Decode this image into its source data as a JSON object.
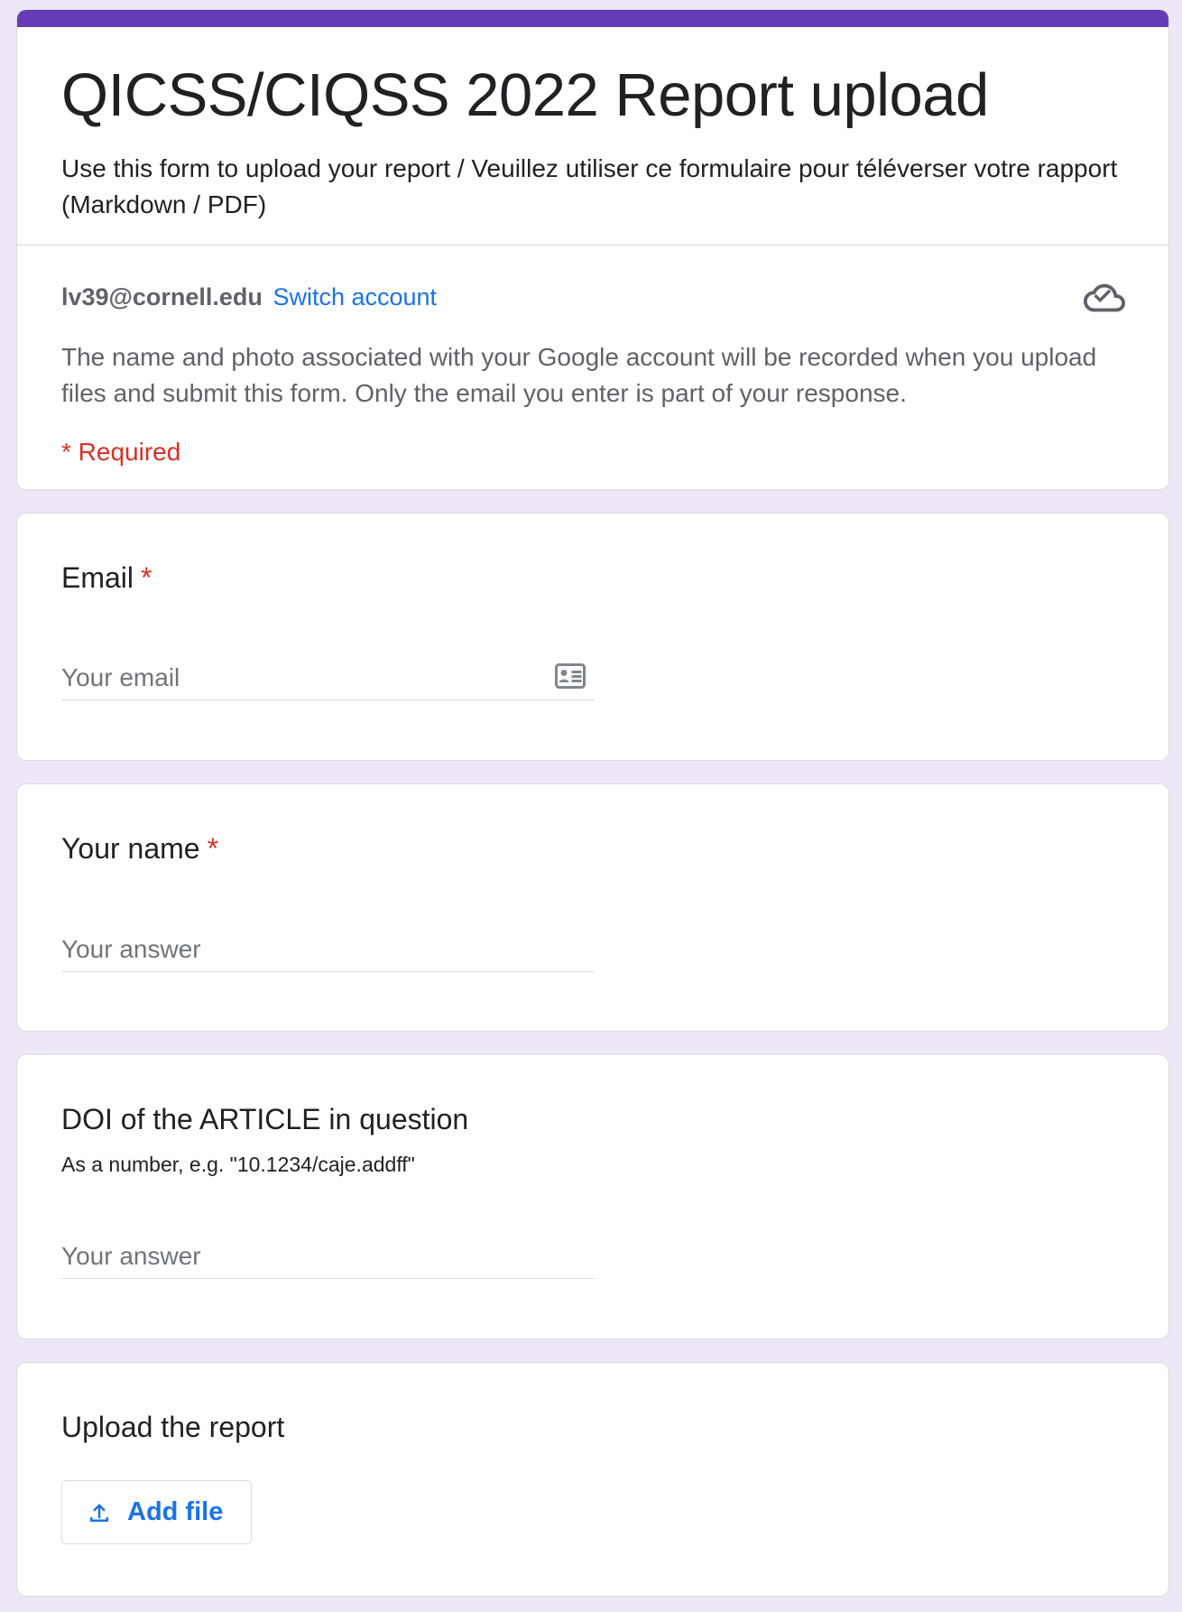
{
  "header": {
    "title": "QICSS/CIQSS 2022 Report upload",
    "description": "Use this form to upload your report / Veuillez utiliser ce formulaire pour téléverser votre rapport (Markdown / PDF)",
    "account_email": "lv39@cornell.edu",
    "switch_account_label": "Switch account",
    "cloud_icon": "cloud-saved-icon",
    "privacy_note": "The name and photo associated with your Google account will be recorded when you upload files and submit this form. Only the email you enter is part of your response.",
    "required_note": "* Required",
    "accent_color": "#673ab7"
  },
  "questions": {
    "email": {
      "title": "Email",
      "required_mark": "*",
      "placeholder": "Your email",
      "value": "",
      "icon": "contact-card-icon"
    },
    "name": {
      "title": "Your name",
      "required_mark": "*",
      "placeholder": "Your answer",
      "value": ""
    },
    "doi": {
      "title": "DOI of the ARTICLE in question",
      "help_text": "As a number, e.g. \"10.1234/caje.addff\"",
      "placeholder": "Your answer",
      "value": ""
    },
    "upload": {
      "title": "Upload the report",
      "button_label": "Add file",
      "icon": "upload-icon"
    }
  },
  "colors": {
    "background": "#ede7f6",
    "link": "#1a73e8",
    "required": "#d93025"
  }
}
